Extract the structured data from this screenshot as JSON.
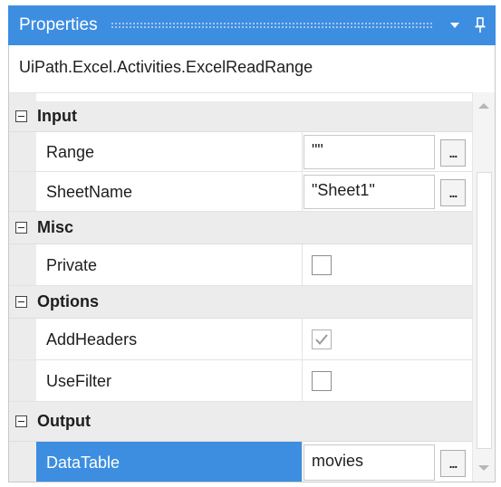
{
  "panel": {
    "title": "Properties",
    "dropdown_icon": "dropdown-arrow-icon",
    "pin_icon": "pin-icon",
    "accent_color": "#3d8ee0"
  },
  "header": {
    "activity_type": "UiPath.Excel.Activities.ExcelReadRange"
  },
  "categories": {
    "input": {
      "label": "Input",
      "range": {
        "name": "Range",
        "value": "\"\"",
        "button": "..."
      },
      "sheetname": {
        "name": "SheetName",
        "value": "\"Sheet1\"",
        "button": "..."
      }
    },
    "misc": {
      "label": "Misc",
      "private": {
        "name": "Private",
        "checked": false
      }
    },
    "options": {
      "label": "Options",
      "addheaders": {
        "name": "AddHeaders",
        "checked": true
      },
      "usefilter": {
        "name": "UseFilter",
        "checked": false
      }
    },
    "output": {
      "label": "Output",
      "datatable": {
        "name": "DataTable",
        "value": "movies",
        "button": "...",
        "selected": true
      }
    }
  }
}
